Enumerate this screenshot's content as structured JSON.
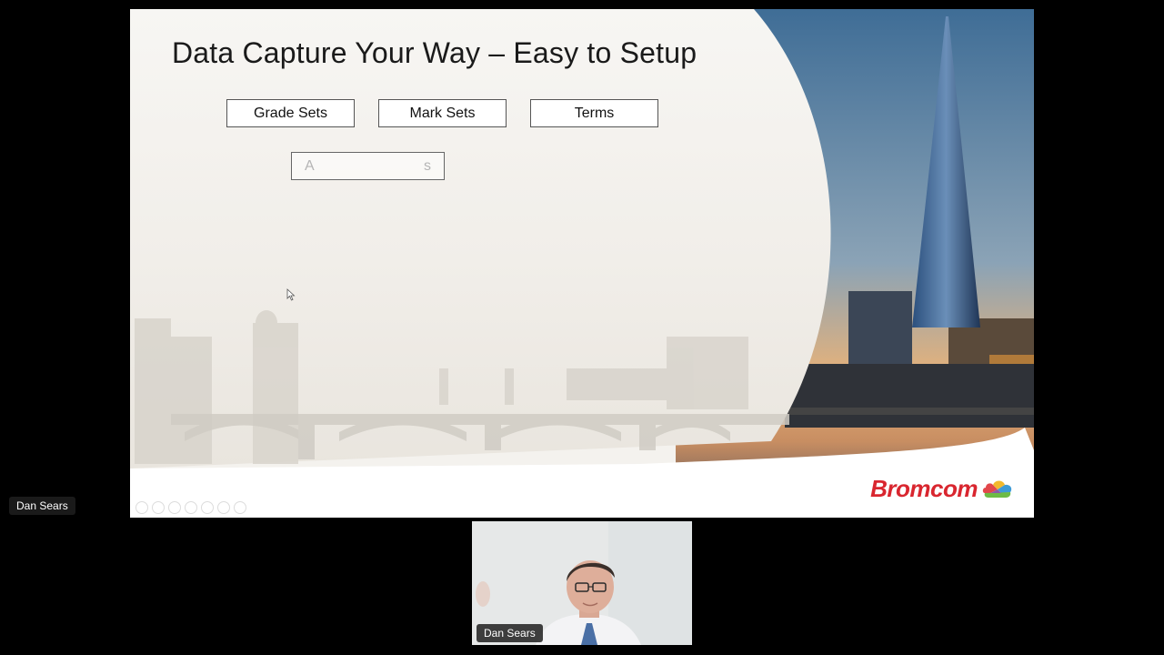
{
  "slide": {
    "title": "Data Capture Your Way – Easy to Setup",
    "boxes": [
      {
        "label": "Grade Sets"
      },
      {
        "label": "Mark Sets"
      },
      {
        "label": "Terms"
      }
    ],
    "ghost_box": {
      "start": "A",
      "end": "s"
    },
    "brand": "Bromcom"
  },
  "participants": {
    "presenter_label": "Dan Sears",
    "video_label": "Dan Sears"
  },
  "colors": {
    "brand_red": "#d9262f",
    "call_background": "#000000"
  }
}
